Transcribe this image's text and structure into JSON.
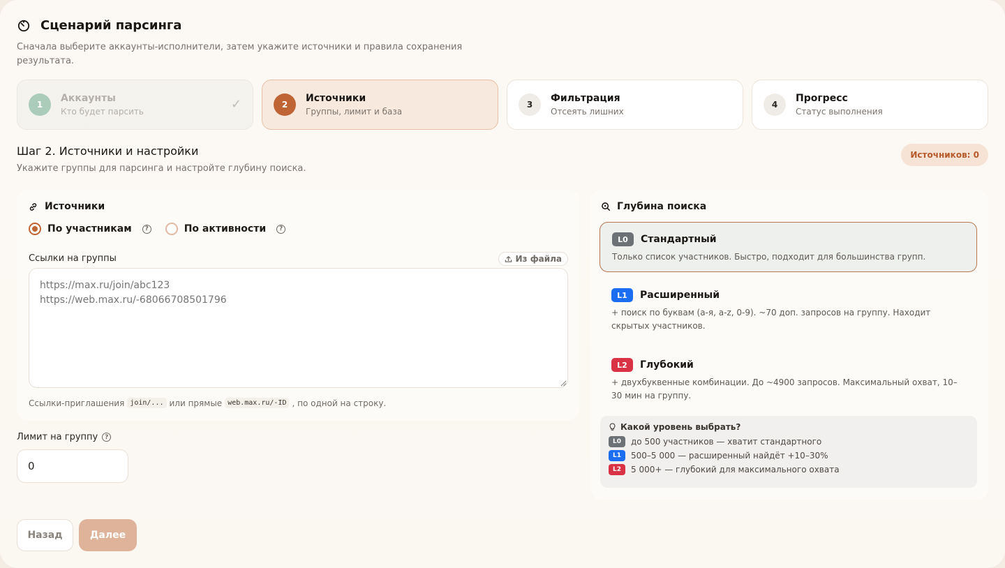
{
  "header": {
    "title": "Сценарий парсинга",
    "subtitle": "Сначала выберите аккаунты-исполнители, затем укажите источники и правила сохранения результата."
  },
  "steps": [
    {
      "num": "1",
      "title": "Аккаунты",
      "desc": "Кто будет парсить",
      "state": "done"
    },
    {
      "num": "2",
      "title": "Источники",
      "desc": "Группы, лимит и база",
      "state": "active"
    },
    {
      "num": "3",
      "title": "Фильтрация",
      "desc": "Отсеять лишних",
      "state": "pending"
    },
    {
      "num": "4",
      "title": "Прогресс",
      "desc": "Статус выполнения",
      "state": "pending"
    }
  ],
  "section": {
    "title": "Шаг 2. Источники и настройки",
    "desc": "Укажите группы для парсинга и настройте глубину поиска.",
    "sources_badge": "Источников: 0"
  },
  "sources": {
    "title": "Источники",
    "mode_options": [
      "По участникам",
      "По активности"
    ],
    "mode_selected": "По участникам",
    "links_label": "Ссылки на группы",
    "from_file": "Из файла",
    "placeholder": "https://max.ru/join/abc123\nhttps://web.max.ru/-68066708501796",
    "hint_prefix": "Ссылки-приглашения",
    "hint_code1": "join/...",
    "hint_mid": "или прямые",
    "hint_code2": "web.max.ru/-ID",
    "hint_suffix": ", по одной на строку."
  },
  "limit": {
    "label": "Лимит на группу",
    "value": "0"
  },
  "buttons": {
    "back": "Назад",
    "next": "Далее"
  },
  "depth": {
    "title": "Глубина поиска",
    "levels": [
      {
        "tag": "L0",
        "name": "Стандартный",
        "desc": "Только список участников. Быстро, подходит для большинства групп.",
        "color": "#6c7176"
      },
      {
        "tag": "L1",
        "name": "Расширенный",
        "desc": "+ поиск по буквам (а-я, a-z, 0-9). ~70 доп. запросов на группу. Находит скрытых участников.",
        "color": "#1b6ef2"
      },
      {
        "tag": "L2",
        "name": "Глубокий",
        "desc": "+ двухбуквенные комбинации. До ~4900 запросов. Максимальный охват, 10–30 мин на группу.",
        "color": "#d93245"
      }
    ],
    "selected": "L0",
    "tip": {
      "title": "Какой уровень выбрать?",
      "rows": [
        {
          "tag": "L0",
          "text": "до 500 участников — хватит стандартного"
        },
        {
          "tag": "L1",
          "text": "500–5 000 — расширенный найдёт +10–30%"
        },
        {
          "tag": "L2",
          "text": "5 000+ — глубокий для максимального охвата"
        }
      ]
    }
  },
  "colors": {
    "accent": "#bf6435",
    "accent_soft": "#f8e9de",
    "done": "#9ec5ae"
  }
}
